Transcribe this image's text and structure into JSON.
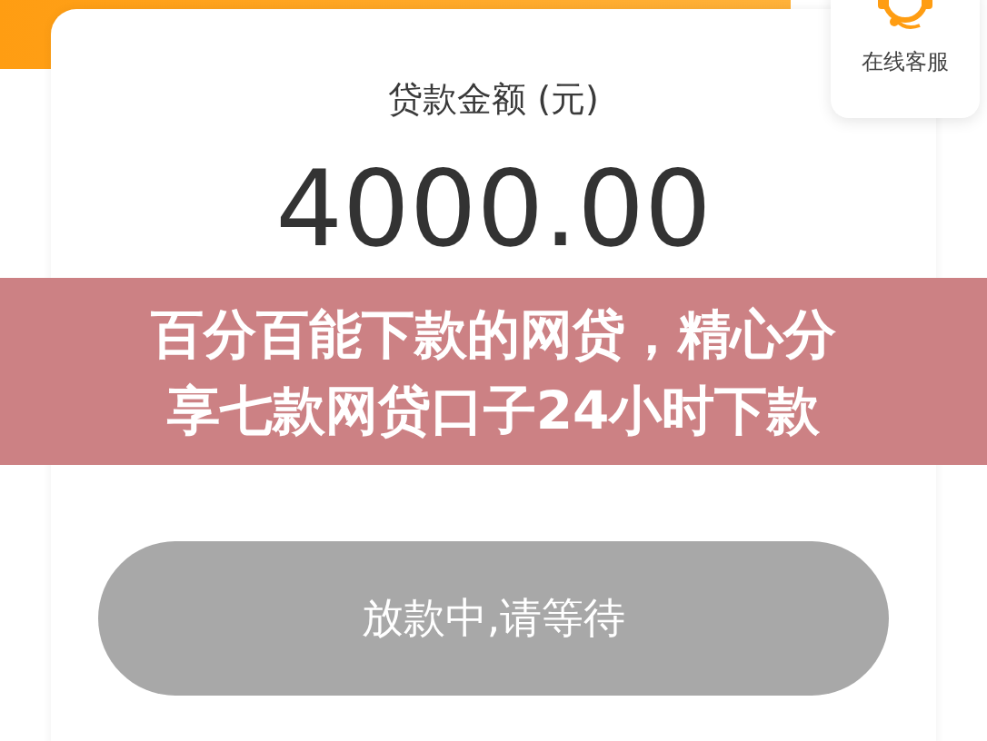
{
  "service_widget": {
    "label": "在线客服"
  },
  "loan_card": {
    "label": "贷款金额 (元)",
    "amount": "4000.00"
  },
  "status_button": {
    "label": "放款中,请等待",
    "disabled": true
  },
  "overlay_banner": {
    "lines": [
      "百分百能下款的网贷，精心分",
      "享七款网贷口子24小时下款"
    ]
  }
}
